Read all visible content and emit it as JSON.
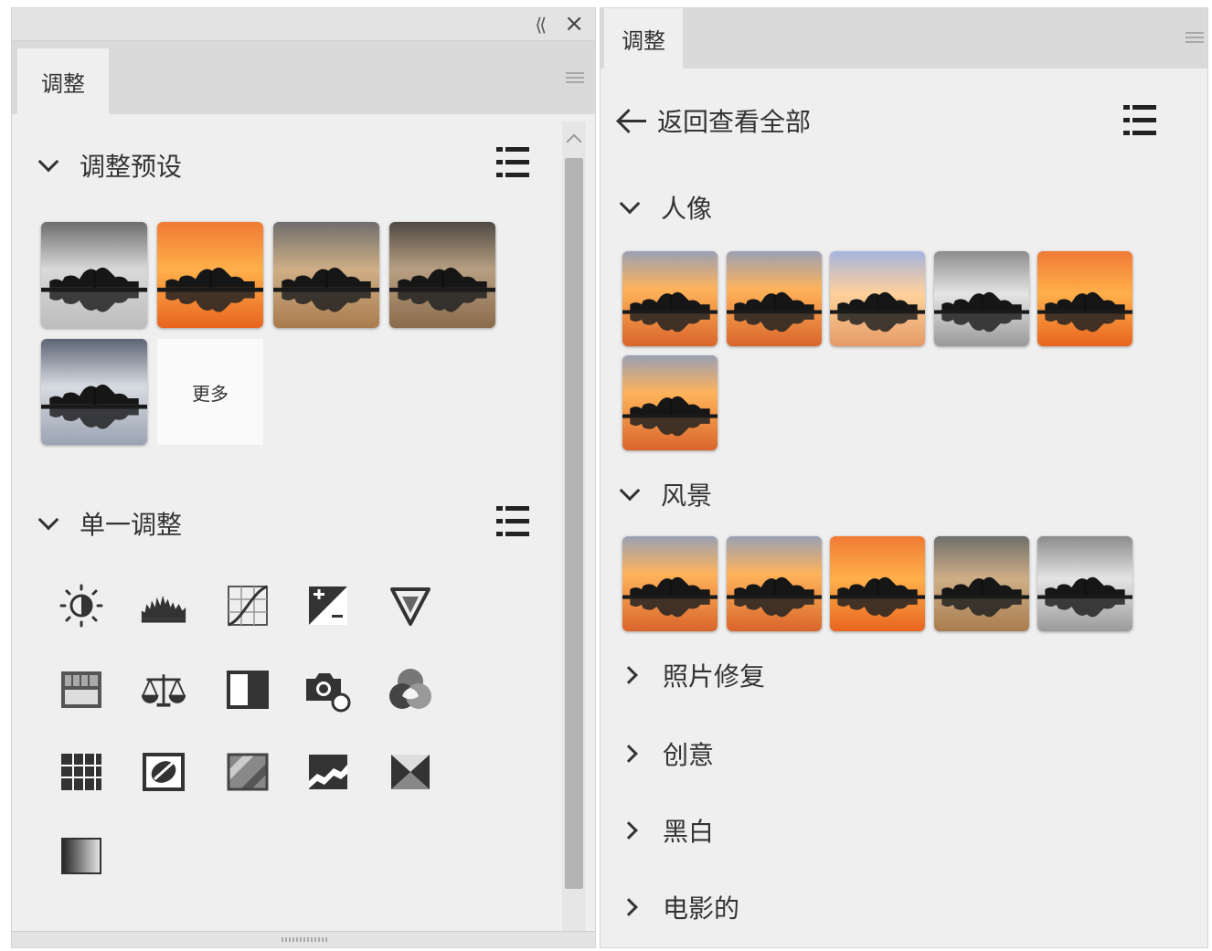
{
  "left_panel": {
    "tab_label": "调整",
    "presets": {
      "title": "调整预设",
      "thumbnails": [
        "default",
        "orange",
        "warm-fade",
        "sepia",
        "cool-blue"
      ],
      "more_label": "更多"
    },
    "single_adjust": {
      "title": "单一调整",
      "icons": [
        "brightness-contrast-icon",
        "levels-icon",
        "curves-icon",
        "exposure-icon",
        "vibrance-icon",
        "hue-saturation-icon",
        "color-balance-icon",
        "black-white-icon",
        "photo-filter-icon",
        "channel-mixer-icon",
        "color-lookup-icon",
        "invert-icon",
        "posterize-icon",
        "threshold-icon",
        "selective-color-icon",
        "gradient-map-icon"
      ]
    }
  },
  "right_panel": {
    "tab_label": "调整",
    "back_label": "返回查看全部",
    "sections": [
      {
        "title": "人像",
        "expanded": true
      },
      {
        "title": "风景",
        "expanded": true
      },
      {
        "title": "照片修复",
        "expanded": false
      },
      {
        "title": "创意",
        "expanded": false
      },
      {
        "title": "黑白",
        "expanded": false
      },
      {
        "title": "电影的",
        "expanded": false
      }
    ]
  },
  "colors": {
    "panel_bg": "#efefef",
    "tabbar_bg": "#dadada",
    "icon_dark": "#333333"
  }
}
